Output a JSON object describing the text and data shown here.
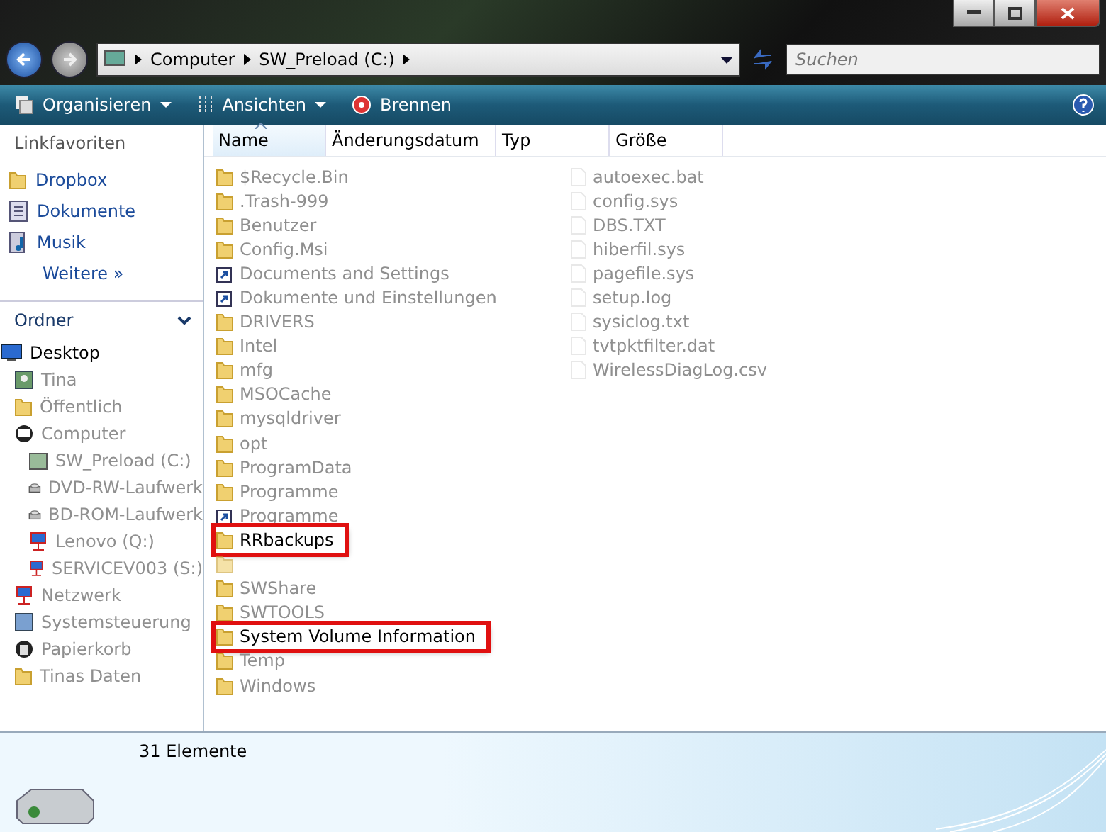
{
  "address_bar": {
    "crumbs": [
      "Computer",
      "SW_Preload (C:)"
    ],
    "search": {
      "placeholder": "Suchen"
    }
  },
  "toolbar": {
    "buttons": [
      {
        "label": "Organisieren",
        "kind": "menu"
      },
      {
        "label": "Ansichten",
        "kind": "menu"
      },
      {
        "label": "Brennen",
        "kind": "plain"
      }
    ]
  },
  "sidebar": {
    "favorites_title": "Linkfavoriten",
    "favorites": [
      {
        "label": "Dropbox",
        "kind": "folder"
      },
      {
        "label": "Dokumente",
        "kind": "document"
      },
      {
        "label": "Musik",
        "kind": "music"
      },
      {
        "label": "Weitere »",
        "kind": "more"
      }
    ],
    "folders_title": "Ordner",
    "tree": [
      {
        "label": "Desktop",
        "kind": "desktop",
        "faded": false,
        "children": [
          {
            "label": "Tina",
            "kind": "user",
            "faded": true
          },
          {
            "label": "Öffentlich",
            "kind": "folder",
            "faded": true
          },
          {
            "label": "Computer",
            "kind": "computer",
            "faded": true,
            "children": [
              {
                "label": "SW_Preload (C:)",
                "kind": "drive",
                "faded": true
              },
              {
                "label": "DVD-RW-Laufwerk",
                "kind": "optical",
                "faded": true
              },
              {
                "label": "BD-ROM-Laufwerk",
                "kind": "optical",
                "faded": true
              },
              {
                "label": "Lenovo (Q:)",
                "kind": "network",
                "faded": true
              },
              {
                "label": "SERVICEV003 (S:)",
                "kind": "network",
                "faded": true
              }
            ]
          },
          {
            "label": "Netzwerk",
            "kind": "network",
            "faded": true
          },
          {
            "label": "Systemsteuerung",
            "kind": "control",
            "faded": true
          },
          {
            "label": "Papierkorb",
            "kind": "trash",
            "faded": true
          },
          {
            "label": "Tinas Daten",
            "kind": "folder",
            "faded": true
          }
        ]
      }
    ]
  },
  "table": {
    "columns": [
      {
        "label": "Name",
        "sorted": true
      },
      {
        "label": "Änderungsdatum",
        "sorted": false
      },
      {
        "label": "Typ",
        "sorted": false
      },
      {
        "label": "Größe",
        "sorted": false
      }
    ],
    "rows": [
      {
        "name": "$Recycle.Bin",
        "kind": "folder",
        "faded": true,
        "highlighted": false
      },
      {
        "name": ".Trash-999",
        "kind": "folder",
        "faded": true,
        "highlighted": false
      },
      {
        "name": "Benutzer",
        "kind": "folder",
        "faded": true,
        "highlighted": false
      },
      {
        "name": "Config.Msi",
        "kind": "folder",
        "faded": true,
        "highlighted": false
      },
      {
        "name": "Documents and Settings",
        "kind": "shortcut",
        "faded": true,
        "highlighted": false
      },
      {
        "name": "Dokumente und Einstellungen",
        "kind": "shortcut",
        "faded": true,
        "highlighted": false
      },
      {
        "name": "DRIVERS",
        "kind": "folder",
        "faded": true,
        "highlighted": false
      },
      {
        "name": "Intel",
        "kind": "folder",
        "faded": true,
        "highlighted": false
      },
      {
        "name": "mfg",
        "kind": "folder",
        "faded": true,
        "highlighted": false
      },
      {
        "name": "MSOCache",
        "kind": "folder",
        "faded": true,
        "highlighted": false
      },
      {
        "name": "mysqldriver",
        "kind": "folder",
        "faded": true,
        "highlighted": false
      },
      {
        "name": "opt",
        "kind": "folder",
        "faded": true,
        "highlighted": false
      },
      {
        "name": "ProgramData",
        "kind": "folder",
        "faded": true,
        "highlighted": false
      },
      {
        "name": "Programme",
        "kind": "folder",
        "faded": true,
        "highlighted": false
      },
      {
        "name": "Programme",
        "kind": "shortcut",
        "faded": true,
        "highlighted": false
      },
      {
        "name": "RRbackups",
        "kind": "folder",
        "faded": false,
        "highlighted": true
      },
      {
        "kind": "folder",
        "faded": true,
        "highlighted": false
      },
      {
        "name": "SWShare",
        "kind": "folder",
        "faded": true,
        "highlighted": false
      },
      {
        "name": "SWTOOLS",
        "kind": "folder",
        "faded": true,
        "highlighted": false
      },
      {
        "name": "System Volume Information",
        "kind": "folder",
        "faded": false,
        "highlighted": true
      },
      {
        "name": "Temp",
        "kind": "folder",
        "faded": true,
        "highlighted": false
      },
      {
        "name": "Windows",
        "kind": "folder",
        "faded": true,
        "highlighted": false
      },
      {
        "name": "autoexec.bat",
        "kind": "file",
        "faded": true,
        "highlighted": false
      },
      {
        "name": "config.sys",
        "kind": "file",
        "faded": true,
        "highlighted": false
      },
      {
        "name": "DBS.TXT",
        "kind": "file",
        "faded": true,
        "highlighted": false
      },
      {
        "name": "hiberfil.sys",
        "kind": "file",
        "faded": true,
        "highlighted": false
      },
      {
        "name": "pagefile.sys",
        "kind": "file",
        "faded": true,
        "highlighted": false
      },
      {
        "name": "setup.log",
        "kind": "file",
        "faded": true,
        "highlighted": false
      },
      {
        "name": "sysiclog.txt",
        "kind": "file",
        "faded": true,
        "highlighted": false
      },
      {
        "name": "tvtpktfilter.dat",
        "kind": "file",
        "faded": true,
        "highlighted": false
      },
      {
        "name": "WirelessDiagLog.csv",
        "kind": "file",
        "faded": true,
        "highlighted": false
      }
    ]
  },
  "status_bar": {
    "count": "31 Elemente"
  }
}
